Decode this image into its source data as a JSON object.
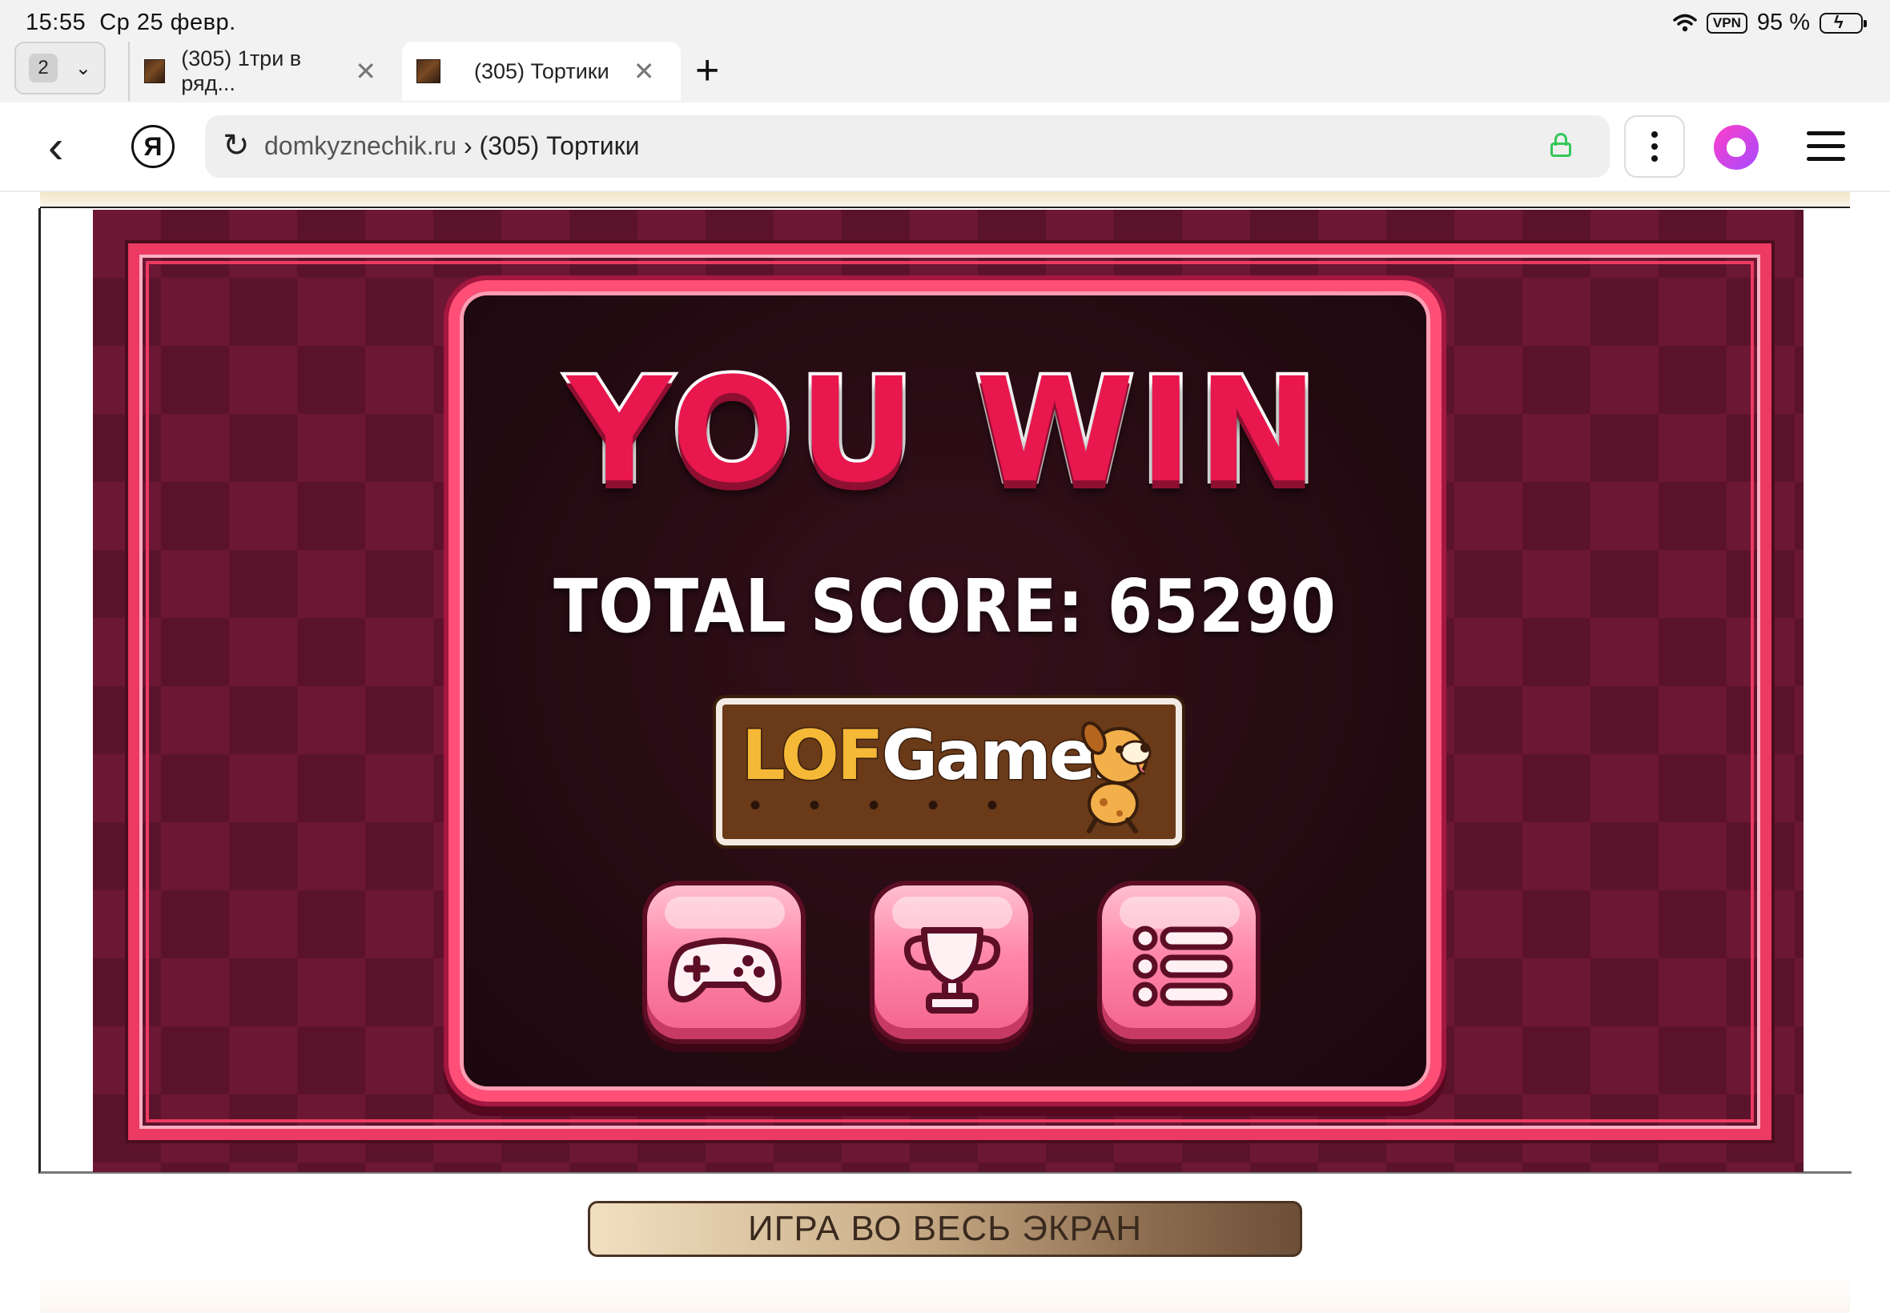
{
  "status_bar": {
    "time": "15:55",
    "date": "Ср 25 февр.",
    "vpn": "VPN",
    "battery": "95 %"
  },
  "tabs": {
    "count": "2",
    "items": [
      {
        "title": "(305) 1три в ряд...",
        "active": false
      },
      {
        "title": "(305) Тортики",
        "active": true
      }
    ]
  },
  "address_bar": {
    "domain": "domkyznechik.ru",
    "separator": "›",
    "page_title": "(305) Тортики",
    "logo": "Я"
  },
  "game": {
    "title": "YOU WIN",
    "score_label": "TOTAL SCORE:",
    "score_value": "65290",
    "sponsor": {
      "part1": "LOF",
      "part2": "Games"
    },
    "buttons": [
      {
        "icon": "gamepad-icon"
      },
      {
        "icon": "trophy-icon"
      },
      {
        "icon": "list-menu-icon"
      }
    ],
    "colors": {
      "background": "#6c1733",
      "frame": "#ec3a62",
      "title": "#e8174e",
      "button": "#ff87a9"
    }
  },
  "fullscreen_label": "ИГРА ВО ВЕСЬ ЭКРАН"
}
